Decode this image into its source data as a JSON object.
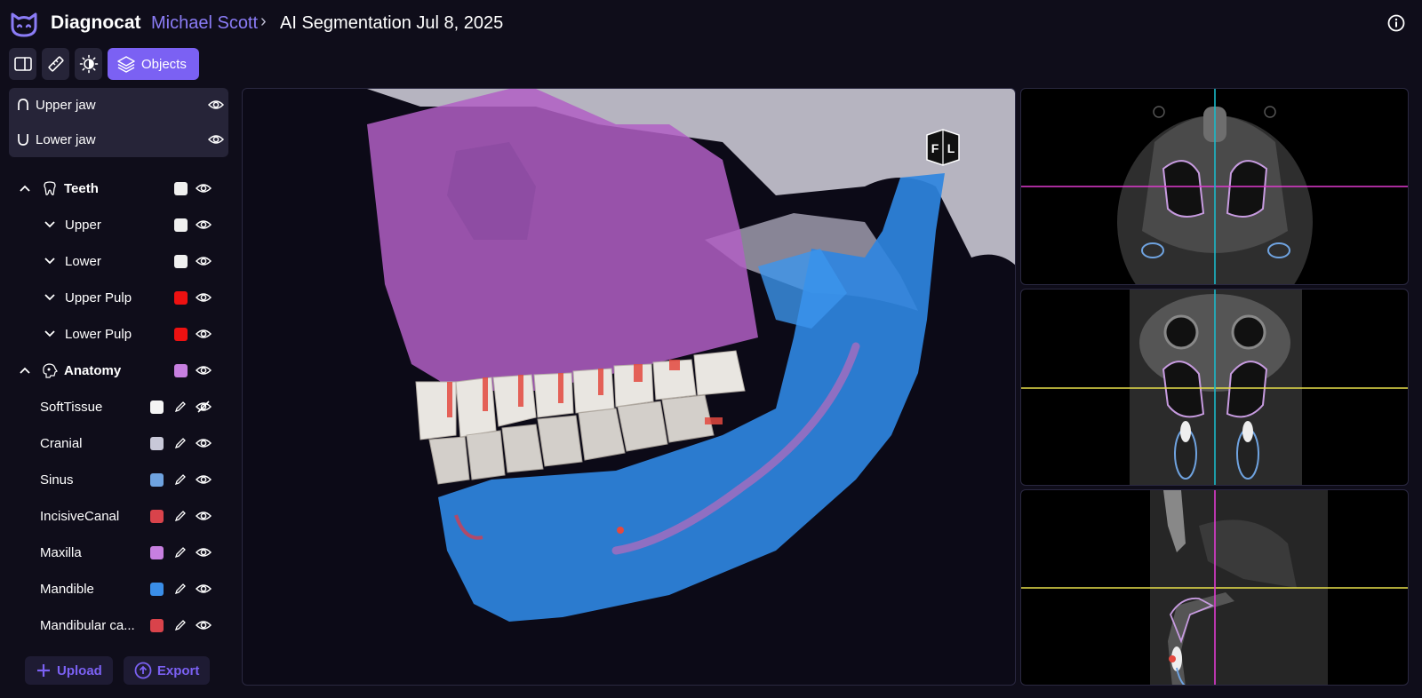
{
  "app": {
    "name": "Diagnocat"
  },
  "breadcrumb": {
    "user": "Michael Scott",
    "separator": ">",
    "page": "AI Segmentation Jul 8, 2025"
  },
  "toolbar": {
    "objects_label": "Objects"
  },
  "jaws": [
    {
      "label": "Upper jaw"
    },
    {
      "label": "Lower jaw"
    }
  ],
  "tree": {
    "teeth": {
      "label": "Teeth",
      "color": "#f0f0f0"
    },
    "upper": {
      "label": "Upper",
      "color": "#f0f0f0"
    },
    "lower": {
      "label": "Lower",
      "color": "#f0f0f0"
    },
    "upper_pulp": {
      "label": "Upper Pulp",
      "color": "#ee1111"
    },
    "lower_pulp": {
      "label": "Lower Pulp",
      "color": "#ee1111"
    },
    "anatomy": {
      "label": "Anatomy",
      "color": "#c77fe0"
    },
    "items": [
      {
        "label": "SoftTissue",
        "color": "#f4f4f4",
        "visible": false
      },
      {
        "label": "Cranial",
        "color": "#c8c8d8",
        "visible": true
      },
      {
        "label": "Sinus",
        "color": "#6fa3e0",
        "visible": true
      },
      {
        "label": "IncisiveCanal",
        "color": "#d9434b",
        "visible": true
      },
      {
        "label": "Maxilla",
        "color": "#c77fe0",
        "visible": true
      },
      {
        "label": "Mandible",
        "color": "#3a8ee8",
        "visible": true
      },
      {
        "label": "Mandibular ca...",
        "color": "#d9434b",
        "visible": true
      }
    ]
  },
  "actions": {
    "upload": "Upload",
    "export": "Export"
  },
  "viewer": {
    "orientation_badge_left": "F",
    "orientation_badge_right": "L"
  },
  "colors": {
    "accent": "#7b61f3",
    "background": "#0f0d1a",
    "panel": "#262438"
  }
}
